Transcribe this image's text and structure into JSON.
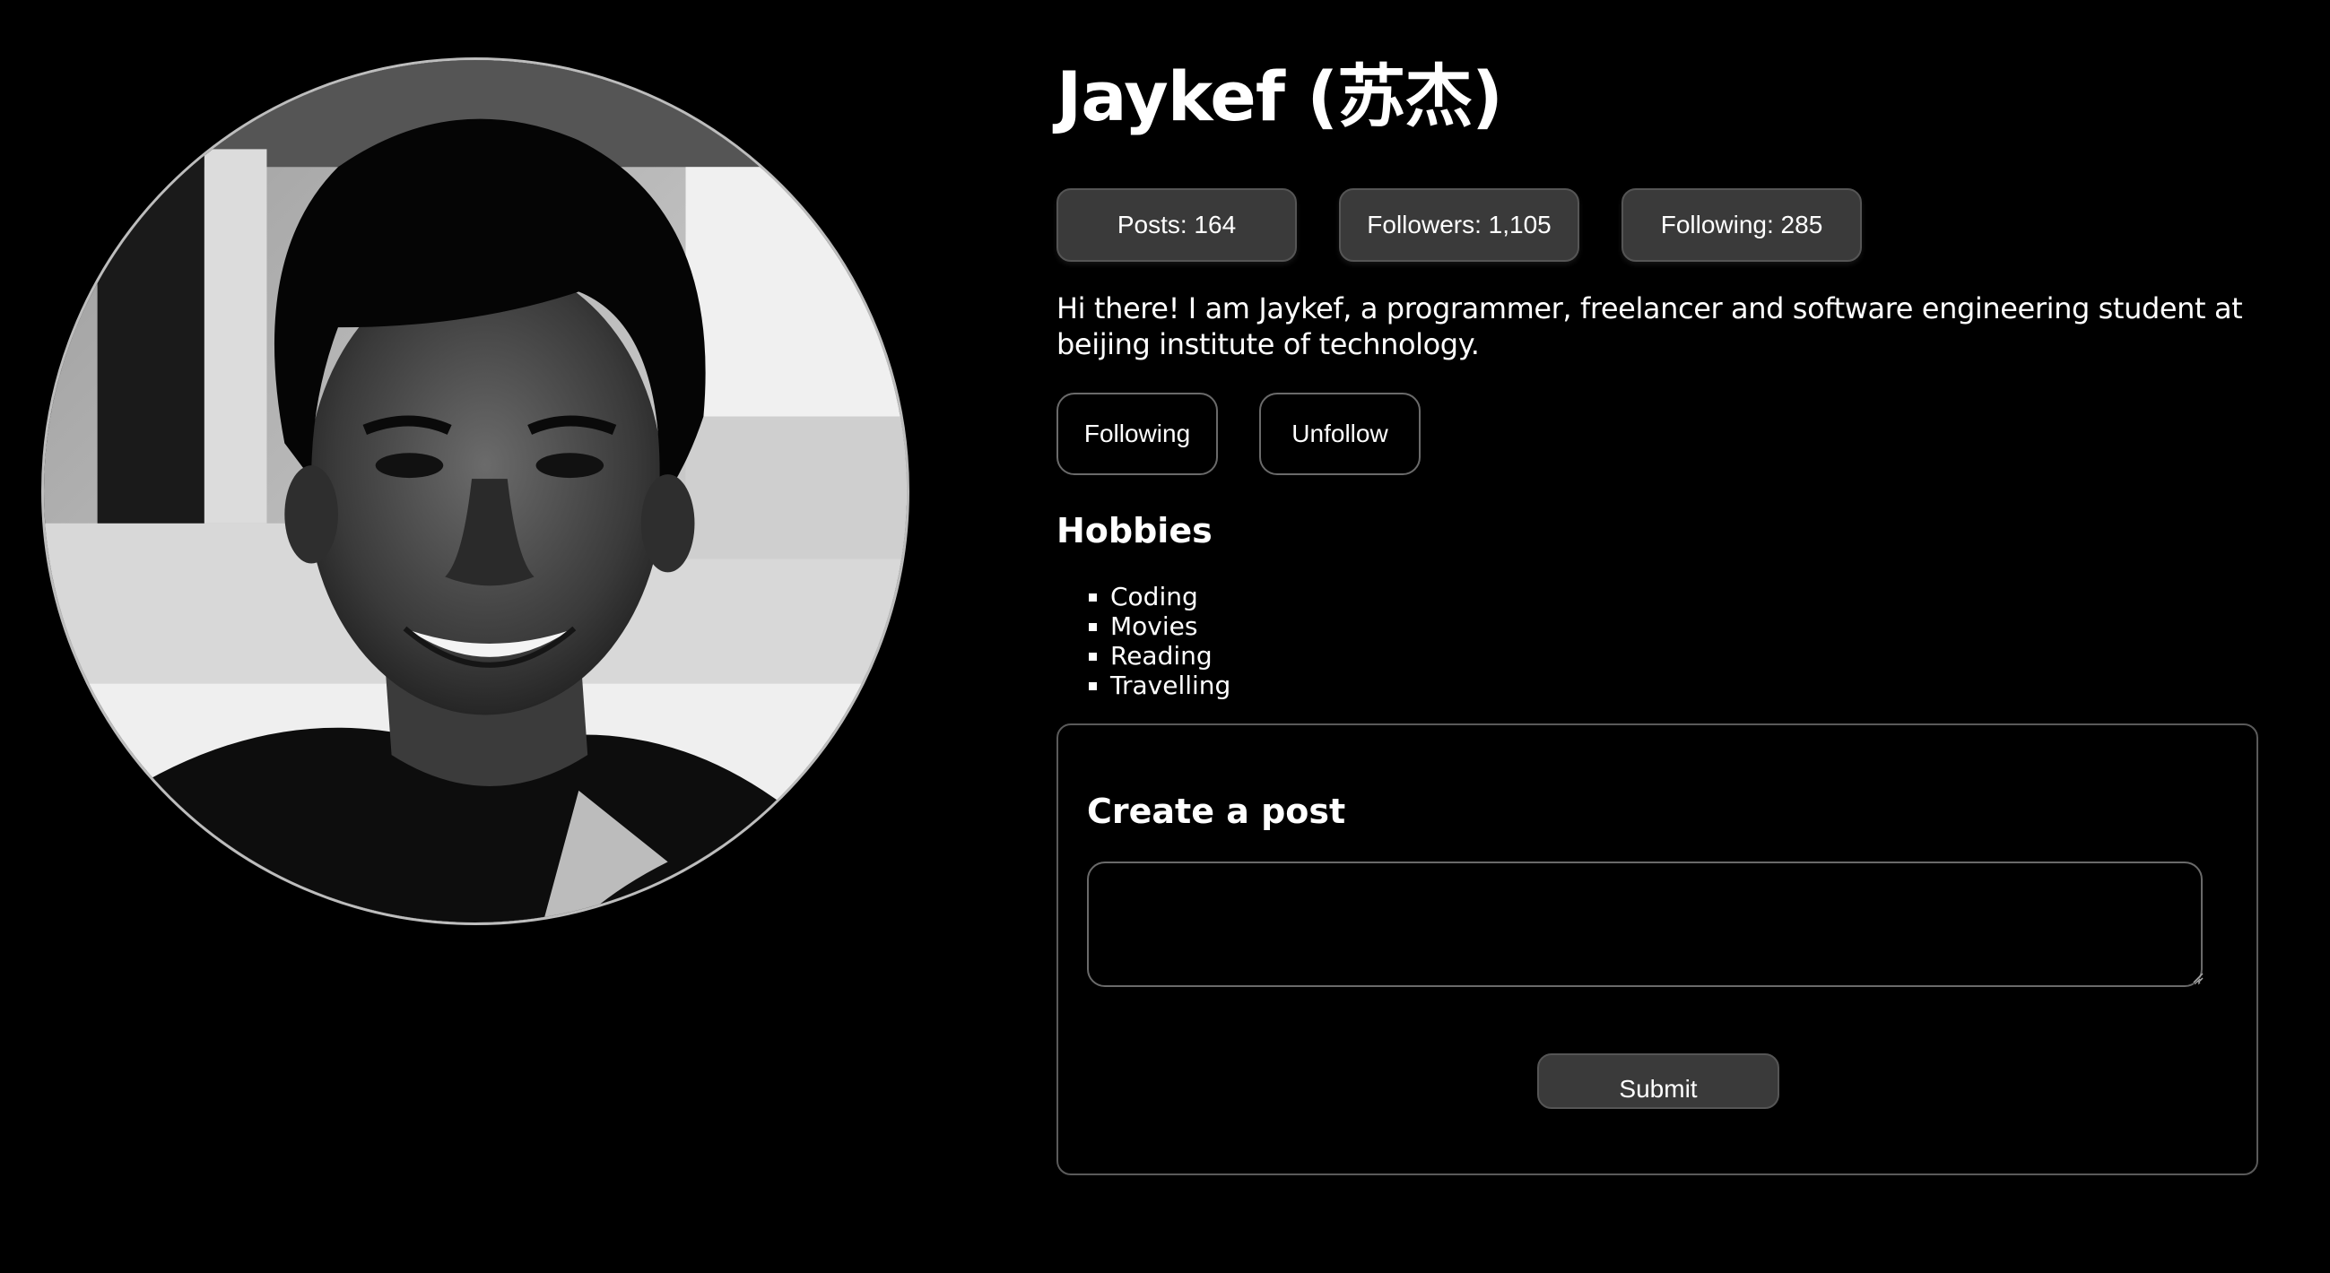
{
  "profile": {
    "name": "Jaykef (苏杰)",
    "avatar_alt": "profile-photo",
    "stats": {
      "posts": "Posts: 164",
      "followers": "Followers: 1,105",
      "following": "Following: 285"
    },
    "bio": "Hi there! I am Jaykef, a programmer, freelancer and software engineering student at beijing institute of technology.",
    "actions": {
      "following_label": "Following",
      "unfollow_label": "Unfollow"
    }
  },
  "hobbies": {
    "title": "Hobbies",
    "items": [
      "Coding",
      "Movies",
      "Reading",
      "Travelling"
    ]
  },
  "create_post": {
    "title": "Create a post",
    "input_value": "",
    "input_placeholder": "",
    "submit_label": "Submit"
  },
  "colors": {
    "background": "#000000",
    "text": "#ffffff",
    "button_fill": "#3a3a3a",
    "border": "#6a6a6a"
  }
}
